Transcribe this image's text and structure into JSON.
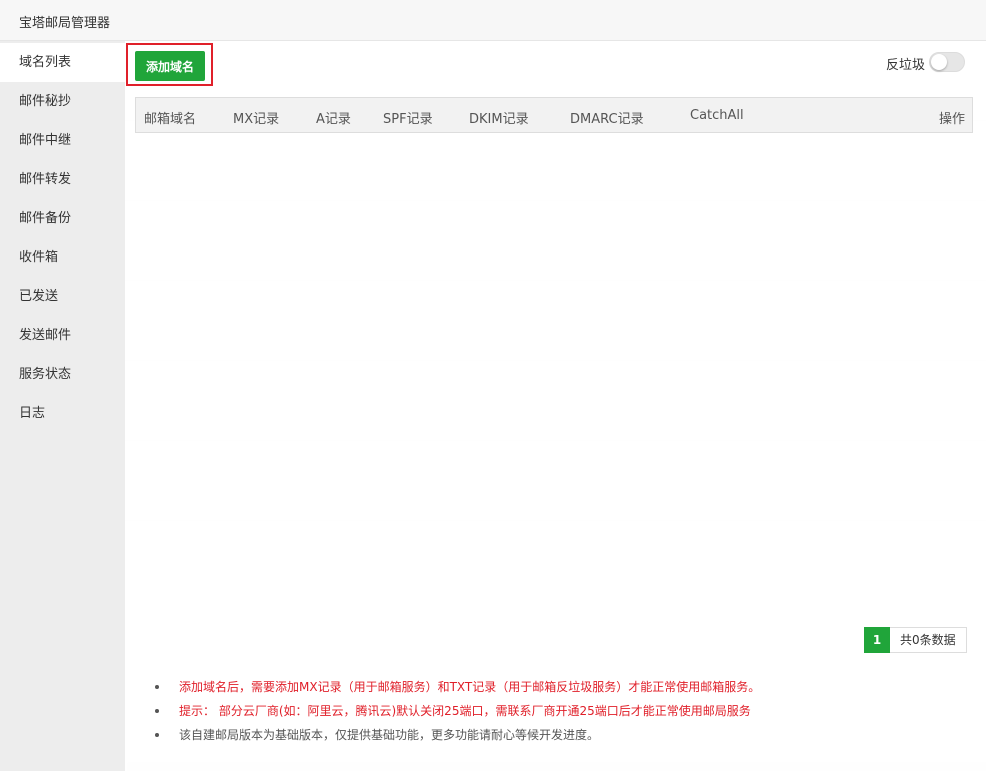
{
  "window": {
    "title": "宝塔邮局管理器"
  },
  "sidebar": {
    "items": [
      {
        "label": "域名列表",
        "active": true
      },
      {
        "label": "邮件秘抄"
      },
      {
        "label": "邮件中继"
      },
      {
        "label": "邮件转发"
      },
      {
        "label": "邮件备份"
      },
      {
        "label": "收件箱"
      },
      {
        "label": "已发送"
      },
      {
        "label": "发送邮件"
      },
      {
        "label": "服务状态"
      },
      {
        "label": "日志"
      }
    ]
  },
  "toolbar": {
    "add_domain_label": "添加域名"
  },
  "spam_filter": {
    "label": "反垃圾",
    "enabled": false
  },
  "table": {
    "headers": [
      "邮箱域名",
      "MX记录",
      "A记录",
      "SPF记录",
      "DKIM记录",
      "DMARC记录",
      "CatchAll",
      "操作"
    ],
    "rows": []
  },
  "pagination": {
    "current_page": "1",
    "total_text": "共0条数据"
  },
  "tips": [
    {
      "text": "添加域名后，需要添加MX记录（用于邮箱服务）和TXT记录（用于邮箱反垃圾服务）才能正常使用邮箱服务。",
      "style": "red"
    },
    {
      "text": "提示： 部分云厂商(如：阿里云，腾讯云)默认关闭25端口，需联系厂商开通25端口后才能正常使用邮局服务",
      "style": "red"
    },
    {
      "text": "该自建邮局版本为基础版本，仅提供基础功能，更多功能请耐心等候开发进度。",
      "style": "gray"
    }
  ],
  "colors": {
    "accent": "#20a53a",
    "warning": "#e0202a",
    "highlight_box": "#e0202a"
  }
}
